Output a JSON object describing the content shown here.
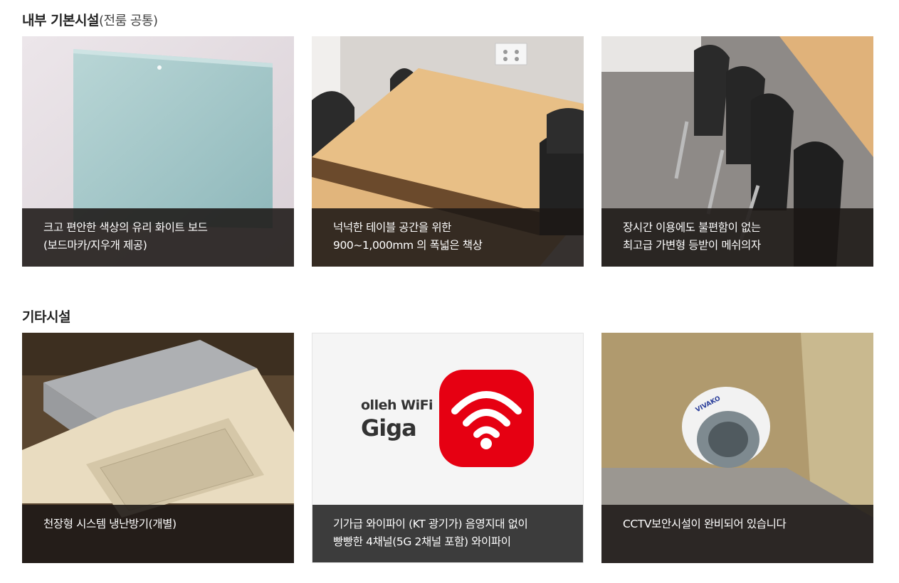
{
  "sections": {
    "internal": {
      "title": "내부 기본시설",
      "subtitle": "(전룸 공통)"
    },
    "other": {
      "title": "기타시설"
    }
  },
  "cards": [
    {
      "line1": "크고 편안한 색상의 유리 화이트 보드",
      "line2": "(보드마카/지우개 제공)"
    },
    {
      "line1": "넉넉한 테이블 공간을 위한",
      "line2": "900~1,000mm 의 폭넓은 책상"
    },
    {
      "line1": "장시간 이용에도 불편함이 없는",
      "line2": "최고급 가변형 등받이 메쉬의자"
    },
    {
      "line1": "천장형 시스템 냉난방기(개별)",
      "line2": ""
    },
    {
      "line1": "기가급 와이파이 (KT 광기가) 음영지대 없이",
      "line2": "빵빵한 4채널(5G 2채널 포함) 와이파이"
    },
    {
      "line1": "CCTV보안시설이 완비되어 있습니다",
      "line2": ""
    }
  ],
  "wifi_logo": {
    "brand": "olleh WiFi",
    "tier": "Giga",
    "accent": "#e60012"
  },
  "camera_brand": "VIVAKO"
}
